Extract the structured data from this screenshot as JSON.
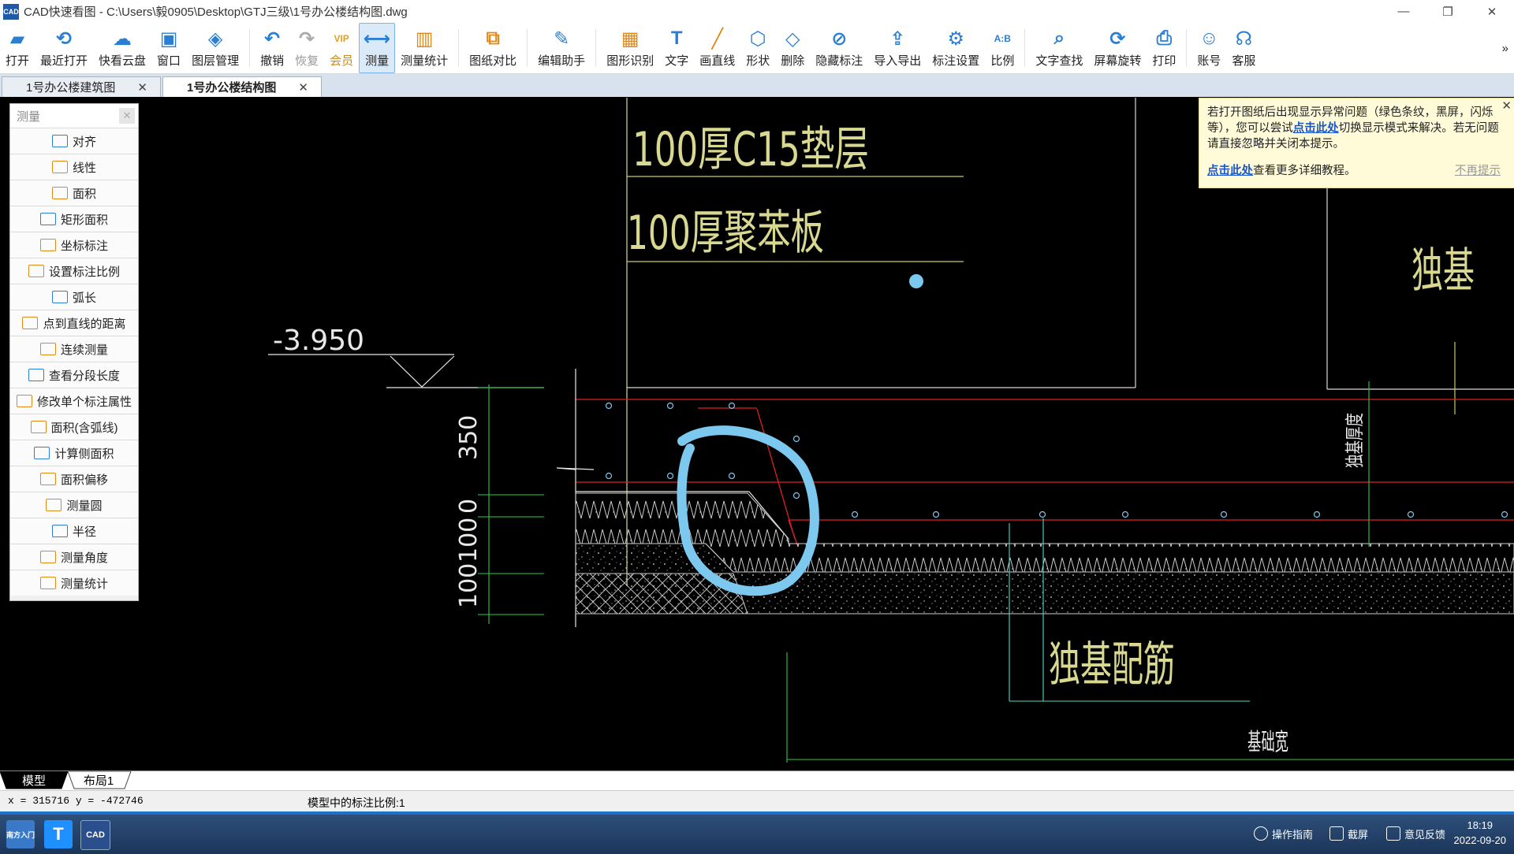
{
  "window": {
    "title": "CAD快速看图 - C:\\Users\\毅0905\\Desktop\\GTJ三级\\1号办公楼结构图.dwg",
    "app_icon_text": "CAD",
    "minimize": "—",
    "restore": "❐",
    "close": "✕"
  },
  "toolbar": {
    "items": [
      {
        "label": "打开",
        "icon": "folder-open-icon",
        "color": "#2a7fd4"
      },
      {
        "label": "最近打开",
        "icon": "recent-clock-icon",
        "color": "#2a7fd4"
      },
      {
        "label": "快看云盘",
        "icon": "cloud-icon",
        "color": "#2a7fd4"
      },
      {
        "label": "窗口",
        "icon": "window-icon",
        "color": "#2a7fd4"
      },
      {
        "label": "图层管理",
        "icon": "layers-icon",
        "color": "#2a7fd4"
      },
      {
        "label": "撤销",
        "icon": "undo-icon",
        "color": "#2a7fd4"
      },
      {
        "label": "恢复",
        "icon": "redo-icon",
        "color": "#aaaaaa"
      },
      {
        "label": "会员",
        "icon": "vip-icon",
        "color": "#e3a21a"
      },
      {
        "label": "测量",
        "icon": "ruler-icon",
        "color": "#2a7fd4"
      },
      {
        "label": "测量统计",
        "icon": "measure-stats-icon",
        "color": "#e08a1a"
      },
      {
        "label": "图纸对比",
        "icon": "compare-icon",
        "color": "#e08a1a"
      },
      {
        "label": "编辑助手",
        "icon": "edit-assistant-icon",
        "color": "#2a7fd4"
      },
      {
        "label": "图形识别",
        "icon": "shape-recognize-icon",
        "color": "#e08a1a"
      },
      {
        "label": "文字",
        "icon": "text-icon",
        "color": "#2a7fd4"
      },
      {
        "label": "画直线",
        "icon": "line-icon",
        "color": "#e08a1a"
      },
      {
        "label": "形状",
        "icon": "shapes-icon",
        "color": "#2a7fd4"
      },
      {
        "label": "删除",
        "icon": "eraser-icon",
        "color": "#2a7fd4"
      },
      {
        "label": "隐藏标注",
        "icon": "hide-eye-icon",
        "color": "#2a7fd4"
      },
      {
        "label": "导入导出",
        "icon": "import-export-icon",
        "color": "#2a7fd4"
      },
      {
        "label": "标注设置",
        "icon": "annotation-settings-icon",
        "color": "#2a7fd4"
      },
      {
        "label": "比例",
        "icon": "scale-icon",
        "color": "#2a7fd4"
      },
      {
        "label": "文字查找",
        "icon": "text-search-icon",
        "color": "#2a7fd4"
      },
      {
        "label": "屏幕旋转",
        "icon": "rotate-screen-icon",
        "color": "#2a7fd4"
      },
      {
        "label": "打印",
        "icon": "printer-icon",
        "color": "#2a7fd4"
      },
      {
        "label": "账号",
        "icon": "user-icon",
        "color": "#2a7fd4"
      },
      {
        "label": "客服",
        "icon": "headset-icon",
        "color": "#2a7fd4"
      }
    ],
    "more": "»"
  },
  "tabs": [
    {
      "label": "1号办公楼建筑图",
      "close": "✕",
      "active": false
    },
    {
      "label": "1号办公楼结构图",
      "close": "✕",
      "active": true
    }
  ],
  "measure_panel": {
    "title": "测量",
    "close": "✕",
    "items": [
      "对齐",
      "线性",
      "面积",
      "矩形面积",
      "坐标标注",
      "设置标注比例",
      "弧长",
      "点到直线的距离",
      "连续测量",
      "查看分段长度",
      "修改单个标注属性",
      "面积(含弧线)",
      "计算侧面积",
      "面积偏移",
      "测量圆",
      "半径",
      "测量角度",
      "测量统计"
    ]
  },
  "notice": {
    "text1": "若打开图纸后出现显示异常问题（绿色条纹，黑屏，闪烁等），您可以尝试",
    "link1": "点击此处",
    "text2": "切换显示模式来解决。若无问题请直接忽略并关闭本提示。",
    "link2": "点击此处",
    "text3": "查看更多详细教程。",
    "never": "不再提示",
    "close": "✕"
  },
  "drawing": {
    "label_c15": "100厚C15垫层",
    "label_foam": "100厚聚苯板",
    "elevation": "-3.950",
    "dim_350": "350",
    "dim_0": "0",
    "dim_100a": "100",
    "dim_100b": "100",
    "label_duji": "独基",
    "label_duji_peijin": "独基配筋",
    "label_jichukuan": "基础宽",
    "label_vertical": "独基厚度",
    "line_color": "#c9c96a",
    "rebar_color": "#e02020",
    "dim_color": "#2ecc40",
    "annotation_color": "#7cc8ee"
  },
  "layout_tabs": [
    "模型",
    "布局1"
  ],
  "status": {
    "coords": "x = 315716  y = -472746",
    "scale": "模型中的标注比例:1"
  },
  "taskbar": {
    "apps": [
      "南方入门",
      "T",
      "CAD"
    ],
    "guide": "操作指南",
    "screenshot": "截屏",
    "feedback": "意见反馈",
    "time": "18:19",
    "date": "2022-09-20"
  }
}
